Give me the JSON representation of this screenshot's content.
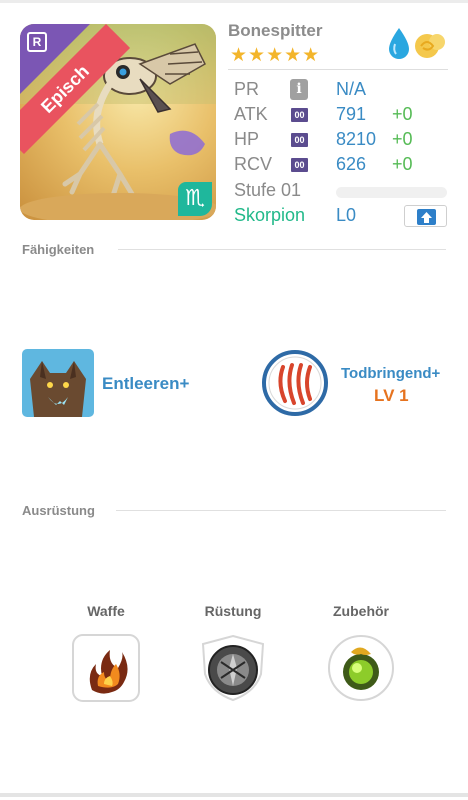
{
  "monster": {
    "name": "Bonespitter",
    "stars": "★★★★★",
    "rarity_banner": "Episch",
    "rarity_badge": "R",
    "zodiac_glyph": "♏"
  },
  "stats": {
    "pr": {
      "label": "PR",
      "value": "N/A",
      "info_icon": "i"
    },
    "atk": {
      "label": "ATK",
      "badge": "00",
      "value": "791",
      "bonus": "+0"
    },
    "hp": {
      "label": "HP",
      "badge": "00",
      "value": "8210",
      "bonus": "+0"
    },
    "rcv": {
      "label": "RCV",
      "badge": "00",
      "value": "626",
      "bonus": "+0"
    },
    "level": {
      "label": "Stufe 01",
      "progress": 0
    },
    "zodiac": {
      "name": "Skorpion",
      "level": "L0"
    }
  },
  "skills_section": {
    "title": "Fähigkeiten",
    "skill1": {
      "label": "Entleeren+",
      "icon": "wolf-portrait-icon"
    },
    "skill2": {
      "name": "Todbringend+",
      "level": "LV 1",
      "icon": "claw-slash-icon"
    }
  },
  "equipment_section": {
    "title": "Ausrüstung",
    "slots": [
      {
        "label": "Waffe",
        "icon": "flame-weapon-icon"
      },
      {
        "label": "Rüstung",
        "icon": "shield-armor-icon"
      },
      {
        "label": "Zubehör",
        "icon": "green-orb-accessory-icon"
      }
    ]
  },
  "colors": {
    "accent_blue": "#3a8bc4",
    "bonus_green": "#55bb55",
    "zodiac_green": "#22b98a",
    "level_orange": "#e6731f",
    "rarity_red": "#e9535f",
    "star_gold": "#f3b52b"
  }
}
